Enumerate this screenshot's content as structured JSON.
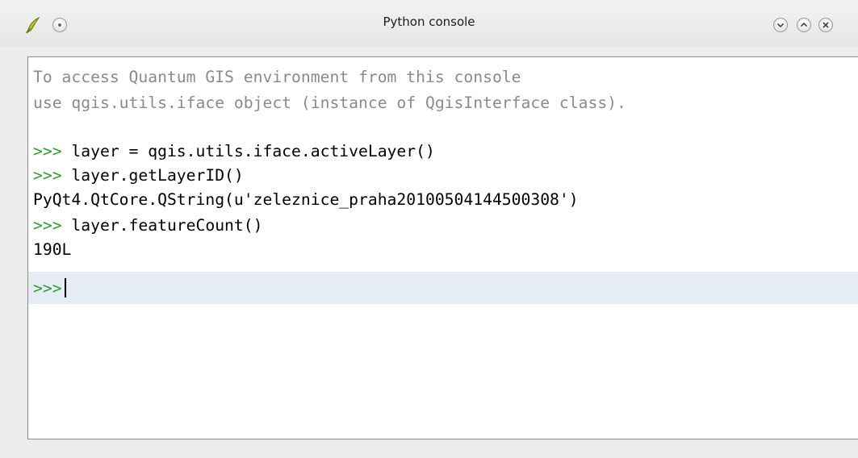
{
  "window": {
    "title": "Python console",
    "app_icon": "qgis-logo-icon",
    "menu_icon": "window-menu-icon",
    "minimize_icon": "minimize-icon",
    "maximize_icon": "maximize-icon",
    "close_icon": "close-icon"
  },
  "console": {
    "intro": [
      "To access Quantum GIS environment from this console",
      "use qgis.utils.iface object (instance of QgisInterface class)."
    ],
    "prompt": ">>>",
    "history": [
      {
        "kind": "input",
        "text": " layer = qgis.utils.iface.activeLayer()"
      },
      {
        "kind": "input",
        "text": " layer.getLayerID()"
      },
      {
        "kind": "output",
        "text": "PyQt4.QtCore.QString(u'zeleznice_praha20100504144500308')"
      },
      {
        "kind": "input",
        "text": " layer.featureCount()"
      },
      {
        "kind": "output",
        "text": "190L"
      }
    ],
    "current_input": "",
    "colors": {
      "intro_text": "#8a8a8a",
      "prompt": "#2e9e2e",
      "current_line_highlight": "#e6edf6"
    }
  }
}
